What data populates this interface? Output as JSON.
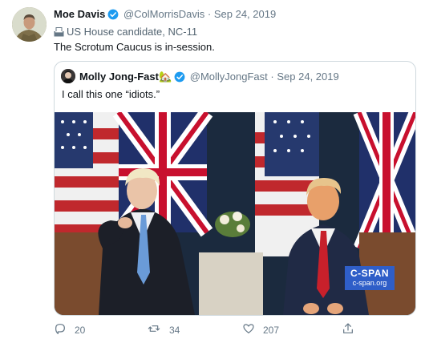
{
  "author": {
    "name": "Moe Davis",
    "handle": "@ColMorrisDavis",
    "separator": "·",
    "date": "Sep 24, 2019",
    "label": "US House candidate, NC-11"
  },
  "tweet_text": "The Scrotum Caucus is in-session.",
  "quote": {
    "name": "Molly Jong-Fast",
    "name_emoji": "🏡",
    "handle": "@MollyJongFast",
    "separator": "·",
    "date": "Sep 24, 2019",
    "text": "I call this one “idiots.”",
    "watermark_title": "C-SPAN",
    "watermark_url": "c-span.org"
  },
  "actions": {
    "replies": "20",
    "retweets": "34",
    "likes": "207"
  },
  "colors": {
    "verified": "#1d9bf0",
    "muted": "#657786",
    "border": "#cfd9de",
    "cspan": "#2f5ec8"
  },
  "icons": [
    "verified-badge-icon",
    "ballot-box-icon",
    "reply-icon",
    "retweet-icon",
    "like-icon",
    "share-icon"
  ]
}
